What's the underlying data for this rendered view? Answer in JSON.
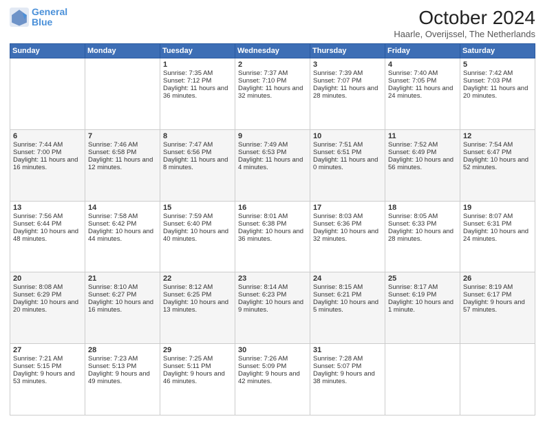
{
  "header": {
    "logo_line1": "General",
    "logo_line2": "Blue",
    "title": "October 2024",
    "subtitle": "Haarle, Overijssel, The Netherlands"
  },
  "days_of_week": [
    "Sunday",
    "Monday",
    "Tuesday",
    "Wednesday",
    "Thursday",
    "Friday",
    "Saturday"
  ],
  "weeks": [
    [
      {
        "day": "",
        "sunrise": "",
        "sunset": "",
        "daylight": ""
      },
      {
        "day": "",
        "sunrise": "",
        "sunset": "",
        "daylight": ""
      },
      {
        "day": "1",
        "sunrise": "Sunrise: 7:35 AM",
        "sunset": "Sunset: 7:12 PM",
        "daylight": "Daylight: 11 hours and 36 minutes."
      },
      {
        "day": "2",
        "sunrise": "Sunrise: 7:37 AM",
        "sunset": "Sunset: 7:10 PM",
        "daylight": "Daylight: 11 hours and 32 minutes."
      },
      {
        "day": "3",
        "sunrise": "Sunrise: 7:39 AM",
        "sunset": "Sunset: 7:07 PM",
        "daylight": "Daylight: 11 hours and 28 minutes."
      },
      {
        "day": "4",
        "sunrise": "Sunrise: 7:40 AM",
        "sunset": "Sunset: 7:05 PM",
        "daylight": "Daylight: 11 hours and 24 minutes."
      },
      {
        "day": "5",
        "sunrise": "Sunrise: 7:42 AM",
        "sunset": "Sunset: 7:03 PM",
        "daylight": "Daylight: 11 hours and 20 minutes."
      }
    ],
    [
      {
        "day": "6",
        "sunrise": "Sunrise: 7:44 AM",
        "sunset": "Sunset: 7:00 PM",
        "daylight": "Daylight: 11 hours and 16 minutes."
      },
      {
        "day": "7",
        "sunrise": "Sunrise: 7:46 AM",
        "sunset": "Sunset: 6:58 PM",
        "daylight": "Daylight: 11 hours and 12 minutes."
      },
      {
        "day": "8",
        "sunrise": "Sunrise: 7:47 AM",
        "sunset": "Sunset: 6:56 PM",
        "daylight": "Daylight: 11 hours and 8 minutes."
      },
      {
        "day": "9",
        "sunrise": "Sunrise: 7:49 AM",
        "sunset": "Sunset: 6:53 PM",
        "daylight": "Daylight: 11 hours and 4 minutes."
      },
      {
        "day": "10",
        "sunrise": "Sunrise: 7:51 AM",
        "sunset": "Sunset: 6:51 PM",
        "daylight": "Daylight: 11 hours and 0 minutes."
      },
      {
        "day": "11",
        "sunrise": "Sunrise: 7:52 AM",
        "sunset": "Sunset: 6:49 PM",
        "daylight": "Daylight: 10 hours and 56 minutes."
      },
      {
        "day": "12",
        "sunrise": "Sunrise: 7:54 AM",
        "sunset": "Sunset: 6:47 PM",
        "daylight": "Daylight: 10 hours and 52 minutes."
      }
    ],
    [
      {
        "day": "13",
        "sunrise": "Sunrise: 7:56 AM",
        "sunset": "Sunset: 6:44 PM",
        "daylight": "Daylight: 10 hours and 48 minutes."
      },
      {
        "day": "14",
        "sunrise": "Sunrise: 7:58 AM",
        "sunset": "Sunset: 6:42 PM",
        "daylight": "Daylight: 10 hours and 44 minutes."
      },
      {
        "day": "15",
        "sunrise": "Sunrise: 7:59 AM",
        "sunset": "Sunset: 6:40 PM",
        "daylight": "Daylight: 10 hours and 40 minutes."
      },
      {
        "day": "16",
        "sunrise": "Sunrise: 8:01 AM",
        "sunset": "Sunset: 6:38 PM",
        "daylight": "Daylight: 10 hours and 36 minutes."
      },
      {
        "day": "17",
        "sunrise": "Sunrise: 8:03 AM",
        "sunset": "Sunset: 6:36 PM",
        "daylight": "Daylight: 10 hours and 32 minutes."
      },
      {
        "day": "18",
        "sunrise": "Sunrise: 8:05 AM",
        "sunset": "Sunset: 6:33 PM",
        "daylight": "Daylight: 10 hours and 28 minutes."
      },
      {
        "day": "19",
        "sunrise": "Sunrise: 8:07 AM",
        "sunset": "Sunset: 6:31 PM",
        "daylight": "Daylight: 10 hours and 24 minutes."
      }
    ],
    [
      {
        "day": "20",
        "sunrise": "Sunrise: 8:08 AM",
        "sunset": "Sunset: 6:29 PM",
        "daylight": "Daylight: 10 hours and 20 minutes."
      },
      {
        "day": "21",
        "sunrise": "Sunrise: 8:10 AM",
        "sunset": "Sunset: 6:27 PM",
        "daylight": "Daylight: 10 hours and 16 minutes."
      },
      {
        "day": "22",
        "sunrise": "Sunrise: 8:12 AM",
        "sunset": "Sunset: 6:25 PM",
        "daylight": "Daylight: 10 hours and 13 minutes."
      },
      {
        "day": "23",
        "sunrise": "Sunrise: 8:14 AM",
        "sunset": "Sunset: 6:23 PM",
        "daylight": "Daylight: 10 hours and 9 minutes."
      },
      {
        "day": "24",
        "sunrise": "Sunrise: 8:15 AM",
        "sunset": "Sunset: 6:21 PM",
        "daylight": "Daylight: 10 hours and 5 minutes."
      },
      {
        "day": "25",
        "sunrise": "Sunrise: 8:17 AM",
        "sunset": "Sunset: 6:19 PM",
        "daylight": "Daylight: 10 hours and 1 minute."
      },
      {
        "day": "26",
        "sunrise": "Sunrise: 8:19 AM",
        "sunset": "Sunset: 6:17 PM",
        "daylight": "Daylight: 9 hours and 57 minutes."
      }
    ],
    [
      {
        "day": "27",
        "sunrise": "Sunrise: 7:21 AM",
        "sunset": "Sunset: 5:15 PM",
        "daylight": "Daylight: 9 hours and 53 minutes."
      },
      {
        "day": "28",
        "sunrise": "Sunrise: 7:23 AM",
        "sunset": "Sunset: 5:13 PM",
        "daylight": "Daylight: 9 hours and 49 minutes."
      },
      {
        "day": "29",
        "sunrise": "Sunrise: 7:25 AM",
        "sunset": "Sunset: 5:11 PM",
        "daylight": "Daylight: 9 hours and 46 minutes."
      },
      {
        "day": "30",
        "sunrise": "Sunrise: 7:26 AM",
        "sunset": "Sunset: 5:09 PM",
        "daylight": "Daylight: 9 hours and 42 minutes."
      },
      {
        "day": "31",
        "sunrise": "Sunrise: 7:28 AM",
        "sunset": "Sunset: 5:07 PM",
        "daylight": "Daylight: 9 hours and 38 minutes."
      },
      {
        "day": "",
        "sunrise": "",
        "sunset": "",
        "daylight": ""
      },
      {
        "day": "",
        "sunrise": "",
        "sunset": "",
        "daylight": ""
      }
    ]
  ]
}
